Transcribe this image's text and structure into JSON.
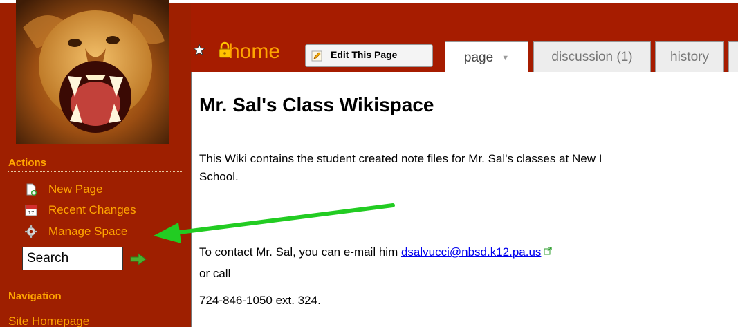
{
  "colors": {
    "sidebar_bg": "#9e1f00",
    "accent_orange": "#ffa500",
    "link_blue": "#0000ee",
    "arrow_green": "#22cc22"
  },
  "sidebar": {
    "logo_icon": "lion-photo",
    "actions_title": "Actions",
    "actions": [
      {
        "label": "New Page",
        "icon": "new-page-icon"
      },
      {
        "label": "Recent Changes",
        "icon": "calendar-icon"
      },
      {
        "label": "Manage Space",
        "icon": "gear-icon"
      }
    ],
    "search_value": "Search",
    "search_go_icon": "right-arrow-icon",
    "navigation_title": "Navigation",
    "nav_items": [
      {
        "label": "Site Homepage"
      }
    ]
  },
  "header": {
    "page_name": "home",
    "edit_button": "Edit This Page",
    "tabs": [
      {
        "label": "page",
        "active": true
      },
      {
        "label": "discussion (1)",
        "active": false
      },
      {
        "label": "history",
        "active": false
      }
    ]
  },
  "content": {
    "title": "Mr. Sal's Class Wikispace",
    "intro": "This Wiki contains the student created note files for Mr. Sal's classes at New I",
    "intro_line2": "School.",
    "contact_prefix": "To contact Mr. Sal, you can e-mail him ",
    "email": "dsalvucci@nbsd.k12.pa.us",
    "or_call": "or call",
    "phone": "724-846-1050 ext. 324."
  }
}
